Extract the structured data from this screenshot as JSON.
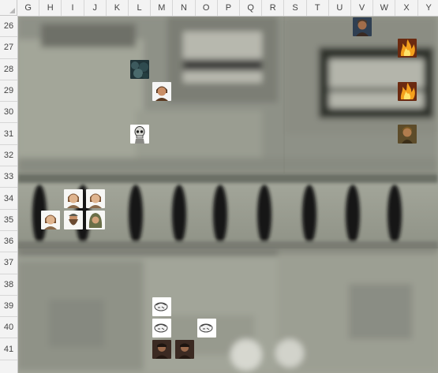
{
  "columns": [
    "G",
    "H",
    "I",
    "J",
    "K",
    "L",
    "M",
    "N",
    "O",
    "P",
    "Q",
    "R",
    "S",
    "T",
    "U",
    "V",
    "W",
    "X",
    "Y"
  ],
  "rows": [
    "26",
    "27",
    "28",
    "29",
    "30",
    "31",
    "32",
    "33",
    "34",
    "35",
    "36",
    "37",
    "38",
    "39",
    "40",
    "41"
  ],
  "tokens": [
    {
      "id": "warrior-v26",
      "kind": "warrior-portrait",
      "cell": "V26"
    },
    {
      "id": "fire-x27",
      "kind": "fire-token",
      "cell": "X27"
    },
    {
      "id": "fire-x29",
      "kind": "fire-token",
      "cell": "X29"
    },
    {
      "id": "forest-l28",
      "kind": "terrain-tile",
      "cell": "L28"
    },
    {
      "id": "hero-m29",
      "kind": "hero-portrait",
      "cell": "M29"
    },
    {
      "id": "skeleton-l31",
      "kind": "skeleton-token",
      "cell": "L31"
    },
    {
      "id": "archer-x31",
      "kind": "archer-portrait",
      "cell": "X31"
    },
    {
      "id": "villager-i34",
      "kind": "villager-portrait",
      "cell": "I34"
    },
    {
      "id": "villager-j34",
      "kind": "villager-portrait",
      "cell": "J34"
    },
    {
      "id": "villager-h35",
      "kind": "villager-portrait",
      "cell": "H35"
    },
    {
      "id": "dwarf-i35",
      "kind": "dwarf-portrait",
      "cell": "I35"
    },
    {
      "id": "hooded-j35",
      "kind": "hooded-portrait",
      "cell": "J35"
    },
    {
      "id": "sketch-m39",
      "kind": "sketch-token",
      "cell": "M39"
    },
    {
      "id": "sketch-m40",
      "kind": "sketch-token",
      "cell": "M40"
    },
    {
      "id": "sketch-o40",
      "kind": "sketch-token",
      "cell": "O40"
    },
    {
      "id": "rogue-m41",
      "kind": "rogue-portrait",
      "cell": "M41"
    },
    {
      "id": "rogue-n41",
      "kind": "rogue-portrait",
      "cell": "N41"
    }
  ]
}
